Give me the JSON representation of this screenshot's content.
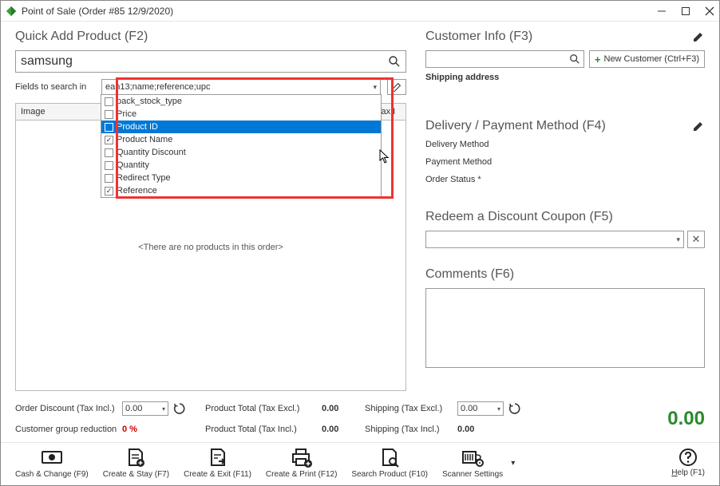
{
  "window": {
    "title": "Point of Sale (Order #85 12/9/2020)"
  },
  "left": {
    "heading": "Quick Add Product (F2)",
    "search_value": "samsung",
    "fields_label": "Fields to search in",
    "combo_value": "ean13;name;reference;upc",
    "dropdown_options": [
      {
        "label": "pack_stock_type",
        "checked": false,
        "selected": false
      },
      {
        "label": "Price",
        "checked": false,
        "selected": false
      },
      {
        "label": "Product ID",
        "checked": false,
        "selected": true
      },
      {
        "label": "Product Name",
        "checked": true,
        "selected": false
      },
      {
        "label": "Quantity Discount",
        "checked": false,
        "selected": false
      },
      {
        "label": "Quantity",
        "checked": false,
        "selected": false
      },
      {
        "label": "Redirect Type",
        "checked": false,
        "selected": false
      },
      {
        "label": "Reference",
        "checked": true,
        "selected": false
      }
    ],
    "grid_cols": {
      "image": "Image",
      "tax": "Tax I"
    },
    "grid_empty": "<There are no products in this order>"
  },
  "right": {
    "customer_heading": "Customer Info (F3)",
    "new_customer": "New Customer (Ctrl+F3)",
    "shipping_label": "Shipping address",
    "delivery_heading": "Delivery / Payment Method (F4)",
    "delivery_method": "Delivery Method",
    "payment_method": "Payment Method",
    "order_status": "Order Status *",
    "coupon_heading": "Redeem a Discount Coupon (F5)",
    "comments_heading": "Comments (F6)"
  },
  "totals": {
    "order_discount_label": "Order Discount (Tax Incl.)",
    "order_discount_value": "0.00",
    "group_reduction_label": "Customer group reduction",
    "group_reduction_value": "0 %",
    "product_total_excl_label": "Product Total (Tax Excl.)",
    "product_total_excl_value": "0.00",
    "product_total_incl_label": "Product Total (Tax Incl.)",
    "product_total_incl_value": "0.00",
    "shipping_excl_label": "Shipping (Tax Excl.)",
    "shipping_excl_value": "0.00",
    "shipping_incl_label": "Shipping (Tax Incl.)",
    "shipping_incl_value": "0.00",
    "grand_total": "0.00"
  },
  "toolbar": {
    "cash": "Cash & Change (F9)",
    "create_stay": "Create & Stay (F7)",
    "create_exit": "Create & Exit (F11)",
    "create_print": "Create & Print (F12)",
    "search_product": "Search Product (F10)",
    "scanner": "Scanner Settings",
    "help": "Help (F1)"
  }
}
